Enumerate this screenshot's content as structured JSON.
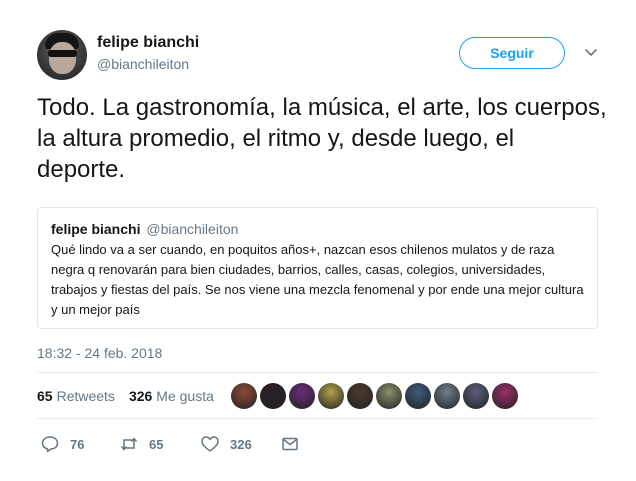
{
  "author": {
    "name": "felipe bianchi",
    "handle": "@bianchileiton"
  },
  "follow_button": {
    "label": "Seguir"
  },
  "tweet": {
    "text": "Todo. La gastronomía, la música, el arte, los cuerpos, la altura promedio, el ritmo y, desde luego, el deporte."
  },
  "quoted_tweet": {
    "name": "felipe bianchi",
    "handle": "@bianchileiton",
    "text": "Qué lindo va a ser cuando, en poquitos años+, nazcan esos chilenos mulatos y de raza negra q renovarán para bien ciudades, barrios, calles, casas, colegios, universidades, trabajos y fiestas del país. Se nos viene una mezcla fenomenal y por ende una mejor cultura y un mejor país"
  },
  "timestamp": "18:32 - 24 feb. 2018",
  "stats": {
    "retweets_count": "65",
    "retweets_label": "Retweets",
    "likes_count": "326",
    "likes_label": "Me gusta"
  },
  "liker_avatars": [
    "#8a4b3a",
    "#2b1f2a",
    "#6a2b7a",
    "#b0a04a",
    "#4a3a2e",
    "#8a8f6a",
    "#3d5a7a",
    "#6f7f8a",
    "#5a5f7a",
    "#9a2f6a"
  ],
  "actions": {
    "replies": "76",
    "retweets": "65",
    "likes": "326"
  },
  "icons": {
    "reply": "reply-icon",
    "retweet": "retweet-icon",
    "like": "heart-icon",
    "dm": "envelope-icon",
    "more": "chevron-down-icon"
  },
  "colors": {
    "accent": "#1da1f2",
    "muted": "#657786",
    "text": "#14171a",
    "border": "#e1e8ed"
  }
}
